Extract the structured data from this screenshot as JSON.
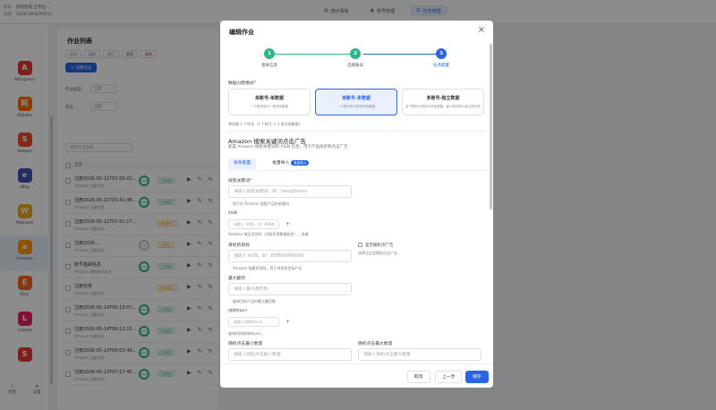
{
  "topbar": {
    "info_lines": [
      {
        "key": "版本",
        "val": "微领智能-全平台..."
      },
      {
        "key": "到期",
        "val": "2026-09-04T00:0..."
      }
    ],
    "tabs": [
      {
        "label": "统计看板",
        "icon": "chart-icon"
      },
      {
        "label": "账号管理",
        "icon": "user-icon"
      },
      {
        "label": "任务管理",
        "icon": "task-icon",
        "active": true
      }
    ]
  },
  "sidebar": {
    "items": [
      {
        "label": "AliExpress",
        "color": "#e53935",
        "glyph": "A"
      },
      {
        "label": "Alibaba",
        "color": "#ff6a00",
        "glyph": "阿"
      },
      {
        "label": "Shopee",
        "color": "#ee4d2d",
        "glyph": "S"
      },
      {
        "label": "eBay",
        "color": "#3f51b5",
        "glyph": "e"
      },
      {
        "label": "Walmart",
        "color": "#f5a623",
        "glyph": "W"
      },
      {
        "label": "Amazon",
        "color": "#ff9900",
        "glyph": "a",
        "active": true
      },
      {
        "label": "Etsy",
        "color": "#f1641e",
        "glyph": "E"
      },
      {
        "label": "Lazada",
        "color": "#e91e63",
        "glyph": "L"
      },
      {
        "label": "",
        "color": "#e53935",
        "glyph": "S"
      }
    ],
    "bottom": [
      {
        "label": "社区",
        "icon": "community-icon"
      },
      {
        "label": "设置",
        "icon": "settings-icon"
      }
    ]
  },
  "tasklist": {
    "title": "作业列表",
    "mini_buttons": [
      "启动",
      "暂停",
      "停止",
      "重置",
      "删除"
    ],
    "create_label": "+ 创建作业",
    "filter1_label": "作业类型",
    "filter1_value": "全部",
    "filter2_label": "状态",
    "filter2_value": "全部",
    "search_placeholder": "搜索作业名称...",
    "col_all": "全选",
    "rows": [
      {
        "title": "注册2026-05-11T03:55:01...",
        "sub": "Amazon 注册任务",
        "pct": "100%",
        "tag": "已完成"
      },
      {
        "title": "注册2026-05-11T03:41:48...",
        "sub": "Amazon 注册任务",
        "pct": "100%",
        "tag": "已完成"
      },
      {
        "title": "注册2026-05-11T07:41:17...",
        "sub": "Amazon 注册任务",
        "pct": "",
        "tag": "等待执行"
      },
      {
        "title": "注册2026-...",
        "sub": "Amazon 注册任务",
        "pct": "0%",
        "tag": "待执行"
      },
      {
        "title": "账号基础信息",
        "sub": "Amazon 提取账号信息",
        "pct": "100%",
        "tag": "已完成"
      },
      {
        "title": "注册任务",
        "sub": "Amazon 注册任务",
        "pct": "",
        "tag": "等待执行"
      },
      {
        "title": "注册2026-05-14T06:15:07...",
        "sub": "Amazon 注册任务",
        "pct": "100%",
        "tag": "已完成"
      },
      {
        "title": "注册2026-05-14T06:12:15...",
        "sub": "Amazon 注册任务",
        "pct": "100%",
        "tag": "已完成"
      },
      {
        "title": "注册2026-05-14T06:03:49...",
        "sub": "Amazon 注册任务",
        "pct": "100%",
        "tag": "已完成"
      },
      {
        "title": "注册2026-05-13T07:17:45...",
        "sub": "Amazon 注册任务",
        "pct": "100%",
        "tag": "已完成"
      }
    ]
  },
  "modal": {
    "title": "编辑作业",
    "steps": [
      {
        "num": "1",
        "label": "基本信息",
        "color": "#2fb58a"
      },
      {
        "num": "2",
        "label": "选择账号",
        "color": "#2fb58a"
      },
      {
        "num": "3",
        "label": "任务配置",
        "color": "#2b64e3"
      }
    ],
    "mode_label": "数据分配模式",
    "modes": [
      {
        "title": "单账号-单数据",
        "desc": "一个账号执行一条任务数据"
      },
      {
        "title": "单账号-多数据",
        "desc": "一个账号执行所有任务数据",
        "selected": true
      },
      {
        "title": "多账号-独立数据",
        "desc": "多个账号分别执行任务数据，每个账号执行独立的任务"
      }
    ],
    "selected_note": "将创建 1 个作业（1 个账号 × 1 条任务数据）",
    "section_title": "Amazon 搜索关键词点击广告",
    "section_desc": "配置 Amazon 搜索关键词和 ASIN 信息，用于产品搜索和点击广告",
    "subtabs": {
      "single": "单条配置",
      "batch": "批量导入",
      "badge": "批量导入"
    },
    "keyword_label": "搜索关键词",
    "keyword_placeholder": "请输入搜索关键词，如：headphones",
    "keyword_hint": "用于在 Amazon 搜索产品的关键词",
    "asin_label": "ASIN",
    "asin_placeholder": "请输入 ASIN，如：B08N...",
    "asin_hint": "Amazon 商品识别码（可能多项数据组合），选填",
    "target_label": "目标的目标",
    "target_placeholder": "请输入 ASIN，如：B08N5WRWNW",
    "target_hint": "Amazon 标题识别码，用于寻找到目标产品",
    "random_ad_label": "是否随机点广告",
    "random_ad_hint": "选择之后会随机点击广告",
    "maxpage_label": "最大翻页",
    "maxpage_placeholder": "请输入最大翻页数",
    "maxpage_hint": "查询目标产品时最大翻页数",
    "exclude_label": "排除的asin",
    "exclude_placeholder": "请输入排除的asin",
    "exclude_hint": "查询时排除掉的asin，",
    "min_label": "随机点击最小数量",
    "min_placeholder": "请输入随机点击最小数量",
    "max_label": "随机点击最大数量",
    "max_placeholder": "请输入随机点击最大数量",
    "buttons": {
      "cancel": "取消",
      "prev": "上一步",
      "save": "保存"
    }
  }
}
